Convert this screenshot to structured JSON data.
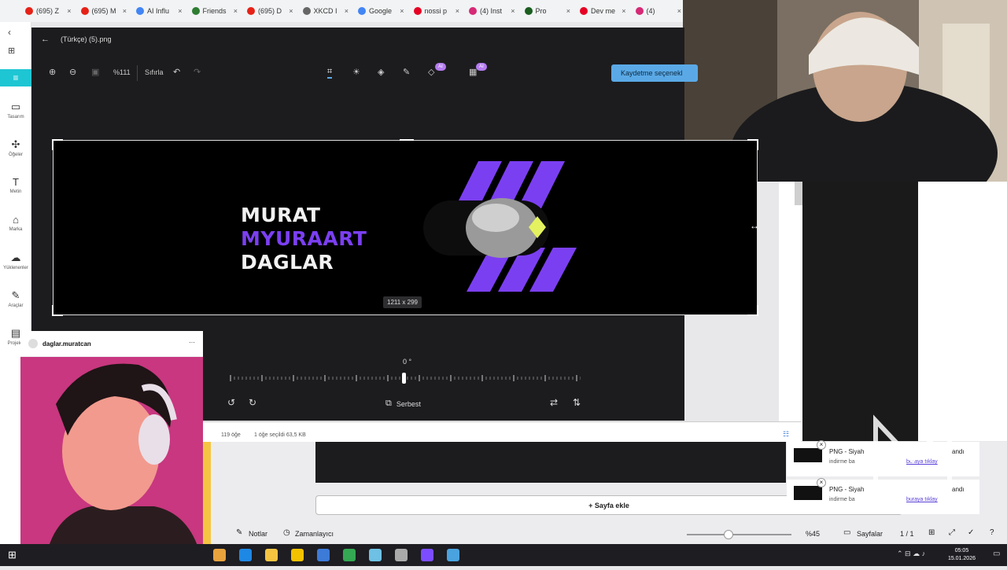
{
  "browser": {
    "tabs": [
      {
        "label": "(695) Z",
        "color": "#e62117"
      },
      {
        "label": "(695) M",
        "color": "#e62117"
      },
      {
        "label": "AI Influ",
        "color": "#4285f4"
      },
      {
        "label": "Friends",
        "color": "#2e7d32"
      },
      {
        "label": "(695) D",
        "color": "#e62117"
      },
      {
        "label": "XKCD I",
        "color": "#666666"
      },
      {
        "label": "Google",
        "color": "#4285f4"
      },
      {
        "label": "nossi p",
        "color": "#e60023"
      },
      {
        "label": "(4) Inst",
        "color": "#d62976"
      },
      {
        "label": "Pro",
        "color": "#1b5e20"
      },
      {
        "label": "Dev me",
        "color": "#e60023"
      },
      {
        "label": "(4)",
        "color": "#d62976"
      }
    ]
  },
  "editor": {
    "file_title": "(Türkçe) (5).png",
    "zoom": "%111",
    "reset_label": "Sıfırla",
    "ai_badge": "AI",
    "save_label": "Kaydetme seçenekl",
    "canvas_lines": [
      "MURAT",
      "MYURAART",
      "DAGLAR"
    ],
    "dimensions": "1211 x 299",
    "rotation": "0 °",
    "mode_label": "Serbest"
  },
  "explorer": {
    "count": "119 öğe",
    "selected": "1 öğe seçildi  63,5 KB"
  },
  "canva": {
    "rail": [
      {
        "icon": "▭",
        "label": "Tasarım"
      },
      {
        "icon": "✣",
        "label": "Öğeler"
      },
      {
        "icon": "T",
        "label": "Metin"
      },
      {
        "icon": "⌂",
        "label": "Marka"
      },
      {
        "icon": "☁",
        "label": "Yüklenenler"
      },
      {
        "icon": "✎",
        "label": "Araçlar"
      },
      {
        "icon": "▤",
        "label": "Projeler"
      }
    ],
    "add_page": "+ Sayfa ekle",
    "notes": "Notlar",
    "timer": "Zamanlayıcı",
    "zoom_pct": "%45",
    "pages": "Sayfalar",
    "page_count": "1 / 1"
  },
  "instagram": {
    "username": "daglar.muratcan",
    "menu": "···"
  },
  "notifications": [
    {
      "title": "PNG - Siyah",
      "sub": "indirme ba",
      "trail": "andı",
      "link": "buraya tıklay"
    },
    {
      "title": "PNG - Siyah",
      "sub": "indirme ba",
      "trail": "andı",
      "link": "buraya tıklay"
    }
  ],
  "taskbar": {
    "time": "05:05",
    "date": "15.01.2026",
    "apps": [
      "#e8a33d",
      "#1e88e5",
      "#f5c542",
      "#f2c200",
      "#3d7bd9",
      "#34a853",
      "#6ec1e4",
      "#aaaaaa",
      "#7c4dff",
      "#4aa3df"
    ]
  }
}
